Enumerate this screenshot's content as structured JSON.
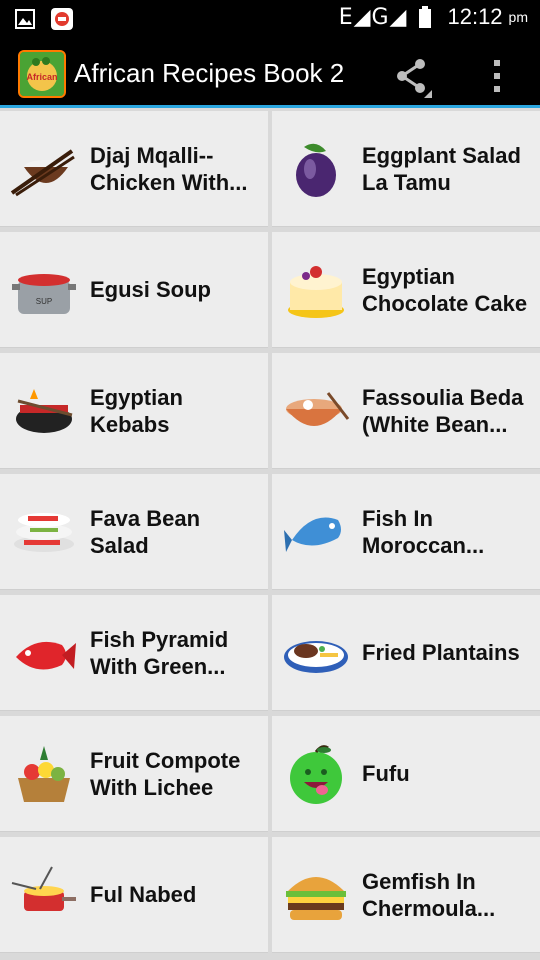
{
  "status_bar": {
    "network": "E◢G◢",
    "time": "12:12",
    "ampm": "pm"
  },
  "app_bar": {
    "title": "African Recipes Book 2",
    "logo_text": "African",
    "share_icon": "share-icon",
    "overflow_icon": "more-vert-icon"
  },
  "recipes": [
    {
      "label": "Djaj Mqalli-- Chicken With...",
      "icon": "rice-bowl-chopsticks-icon"
    },
    {
      "label": "Eggplant Salad La Tamu",
      "icon": "eggplant-icon"
    },
    {
      "label": "Egusi Soup",
      "icon": "soup-pot-icon"
    },
    {
      "label": "Egyptian Chocolate Cake",
      "icon": "cake-icon"
    },
    {
      "label": "Egyptian Kebabs",
      "icon": "grill-kebab-icon"
    },
    {
      "label": "Fassoulia Beda (White Bean...",
      "icon": "noodle-bowl-icon"
    },
    {
      "label": "Fava Bean Salad",
      "icon": "salad-plates-icon"
    },
    {
      "label": "Fish In Moroccan...",
      "icon": "blue-fish-icon"
    },
    {
      "label": "Fish Pyramid With Green...",
      "icon": "red-fish-icon"
    },
    {
      "label": "Fried Plantains",
      "icon": "plate-steak-icon"
    },
    {
      "label": "Fruit Compote With Lichee",
      "icon": "fruit-basket-icon"
    },
    {
      "label": "Fufu",
      "icon": "green-apple-face-icon"
    },
    {
      "label": "Ful Nabed",
      "icon": "fondue-pot-icon"
    },
    {
      "label": "Gemfish In Chermoula...",
      "icon": "burger-icon"
    }
  ]
}
